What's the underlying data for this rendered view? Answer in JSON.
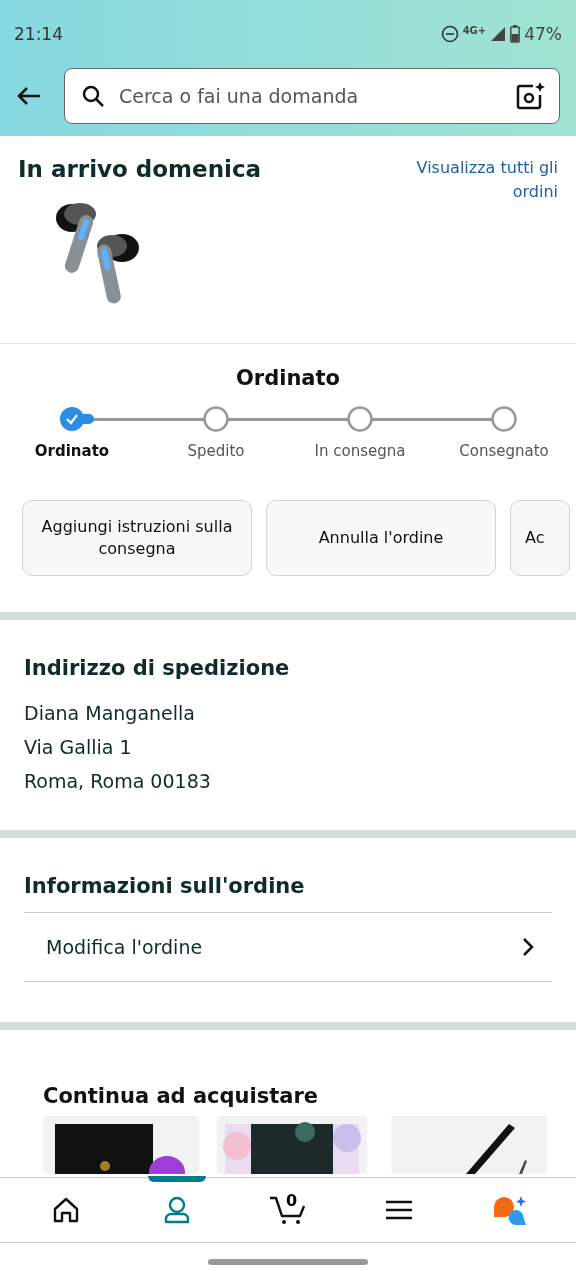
{
  "status_bar": {
    "time": "21:14",
    "network": "4G+",
    "battery": "47%"
  },
  "search": {
    "placeholder": "Cerca o fai una domanda"
  },
  "arrival": {
    "title": "In arrivo domenica",
    "link": "Visualizza tutti gli ordini"
  },
  "tracker": {
    "title": "Ordinato",
    "steps": [
      {
        "label": "Ordinato",
        "done": true
      },
      {
        "label": "Spedito",
        "done": false
      },
      {
        "label": "In consegna",
        "done": false
      },
      {
        "label": "Consegnato",
        "done": false
      }
    ]
  },
  "actions": [
    "Aggiungi istruzioni sulla consegna",
    "Annulla l'ordine",
    "Ac"
  ],
  "address": {
    "title": "Indirizzo di spedizione",
    "lines": [
      "Diana Manganella",
      "Via Gallia 1",
      "Roma, Roma 00183"
    ]
  },
  "order_info": {
    "title": "Informazioni sull'ordine",
    "rows": [
      "Modifica l'ordine"
    ]
  },
  "continue": {
    "title": "Continua ad acquistare"
  },
  "nav": [
    {
      "kind": "home",
      "selected": false
    },
    {
      "kind": "account",
      "selected": true
    },
    {
      "kind": "cart",
      "selected": false,
      "count": "0"
    },
    {
      "kind": "menu",
      "selected": false
    },
    {
      "kind": "assistant",
      "selected": false
    }
  ]
}
